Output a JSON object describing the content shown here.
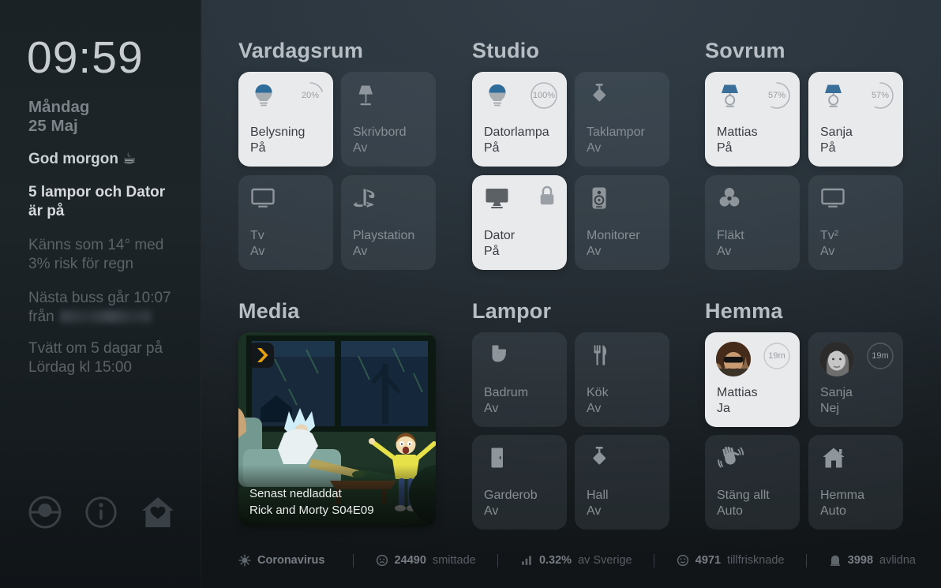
{
  "sidebar": {
    "clock": "09:59",
    "date_line1": "Måndag",
    "date_line2": "25 Maj",
    "greeting": "God morgon ☕",
    "status_message": "5 lampor och Dator är på",
    "weather": "Känns som 14° med 3% risk för regn",
    "bus_line": "Nästa buss går 10:07",
    "bus_from": "från",
    "laundry": "Tvätt om 5 dagar på Lördag kl 15:00"
  },
  "sections": [
    {
      "title": "Vardagsrum",
      "tiles": [
        {
          "label": "Belysning",
          "value": "På",
          "percent": "20%",
          "pnum": 20
        },
        {
          "label": "Skrivbord",
          "value": "Av"
        },
        {
          "label": "Tv",
          "value": "Av"
        },
        {
          "label": "Playstation",
          "value": "Av"
        }
      ]
    },
    {
      "title": "Studio",
      "tiles": [
        {
          "label": "Datorlampa",
          "value": "På",
          "percent": "100%",
          "pnum": 100
        },
        {
          "label": "Taklampor",
          "value": "Av"
        },
        {
          "label": "Dator",
          "value": "På"
        },
        {
          "label": "Monitorer",
          "value": "Av"
        }
      ]
    },
    {
      "title": "Sovrum",
      "tiles": [
        {
          "label": "Mattias",
          "value": "På",
          "percent": "57%",
          "pnum": 57
        },
        {
          "label": "Sanja",
          "value": "På",
          "percent": "57%",
          "pnum": 57
        },
        {
          "label": "Fläkt",
          "value": "Av"
        },
        {
          "label": "Tv²",
          "value": "Av"
        }
      ]
    },
    {
      "title": "Media",
      "media": {
        "line1": "Senast nedladdat",
        "line2": "Rick and Morty S04E09"
      }
    },
    {
      "title": "Lampor",
      "tiles": [
        {
          "label": "Badrum",
          "value": "Av"
        },
        {
          "label": "Kök",
          "value": "Av"
        },
        {
          "label": "Garderob",
          "value": "Av"
        },
        {
          "label": "Hall",
          "value": "Av"
        }
      ]
    },
    {
      "title": "Hemma",
      "tiles": [
        {
          "label": "Mattias",
          "value": "Ja",
          "badge": "19m"
        },
        {
          "label": "Sanja",
          "value": "Nej",
          "badge": "19m"
        },
        {
          "label": "Stäng allt",
          "value": "Auto"
        },
        {
          "label": "Hemma",
          "value": "Auto"
        }
      ]
    }
  ],
  "statusbar": {
    "items": [
      {
        "bold": "Coronavirus",
        "label": ""
      },
      {
        "bold": "24490",
        "label": "smittade"
      },
      {
        "bold": "0.32%",
        "label": "av Sverige"
      },
      {
        "bold": "4971",
        "label": "tillfrisknade"
      },
      {
        "bold": "3998",
        "label": "avlidna"
      }
    ]
  },
  "colors": {
    "accent_blue": "#2e6d9b",
    "plex_orange": "#e5a00d",
    "active_tile": "#e9eaec"
  }
}
